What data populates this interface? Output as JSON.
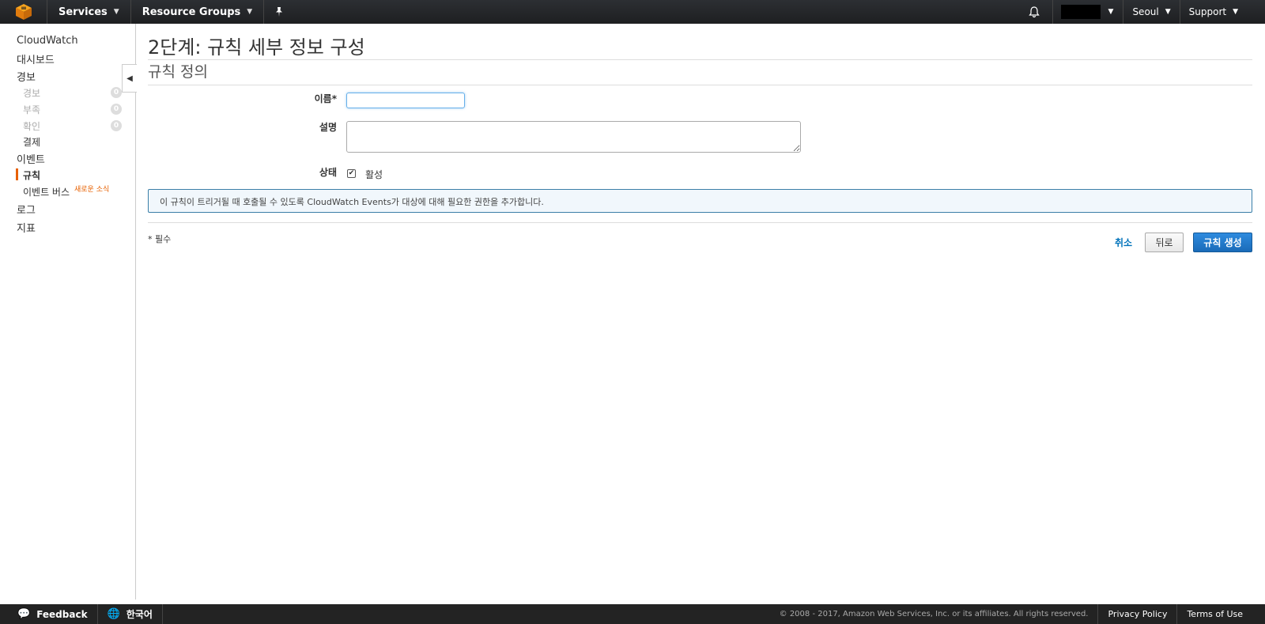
{
  "topbar": {
    "services": "Services",
    "resource_groups": "Resource Groups",
    "region": "Seoul",
    "support": "Support"
  },
  "sidebar": {
    "cloudwatch": "CloudWatch",
    "dashboard": "대시보드",
    "alarms": "경보",
    "alarm_sub": {
      "label": "경보",
      "count": "0"
    },
    "insufficient": {
      "label": "부족",
      "count": "0"
    },
    "ok": {
      "label": "확인",
      "count": "0"
    },
    "billing": "결제",
    "events": "이벤트",
    "rules": "규칙",
    "event_buses": "이벤트 버스",
    "new_badge": "새로운 소식",
    "logs": "로그",
    "metrics": "지표"
  },
  "main": {
    "page_title": "2단계: 규칙 세부 정보 구성",
    "section_title": "규칙 정의",
    "name_label": "이름*",
    "name_value": "",
    "desc_label": "설명",
    "desc_value": "",
    "state_label": "상태",
    "state_checked": true,
    "state_option": "활성",
    "info_text": "이 규칙이 트리거될 때 호출될 수 있도록 CloudWatch Events가 대상에 대해 필요한 권한을 추가합니다.",
    "required_note": "* 필수",
    "cancel": "취소",
    "back": "뒤로",
    "create": "규칙 생성"
  },
  "footer": {
    "feedback": "Feedback",
    "language": "한국어",
    "copyright": "© 2008 - 2017, Amazon Web Services, Inc. or its affiliates. All rights reserved.",
    "privacy": "Privacy Policy",
    "terms": "Terms of Use"
  },
  "icons": {
    "logo": "aws-cube-icon",
    "pin": "pin-icon",
    "bell": "bell-icon",
    "collapse": "collapse-left-icon",
    "feedback": "speech-bubble-icon",
    "language": "globe-icon",
    "check": "checkbox-check-icon"
  },
  "colors": {
    "topbar": "#232323",
    "accent_orange": "#e76000",
    "primary_button": "#1a6bb8",
    "link": "#0073bb",
    "info_border": "#3b7fa8"
  }
}
